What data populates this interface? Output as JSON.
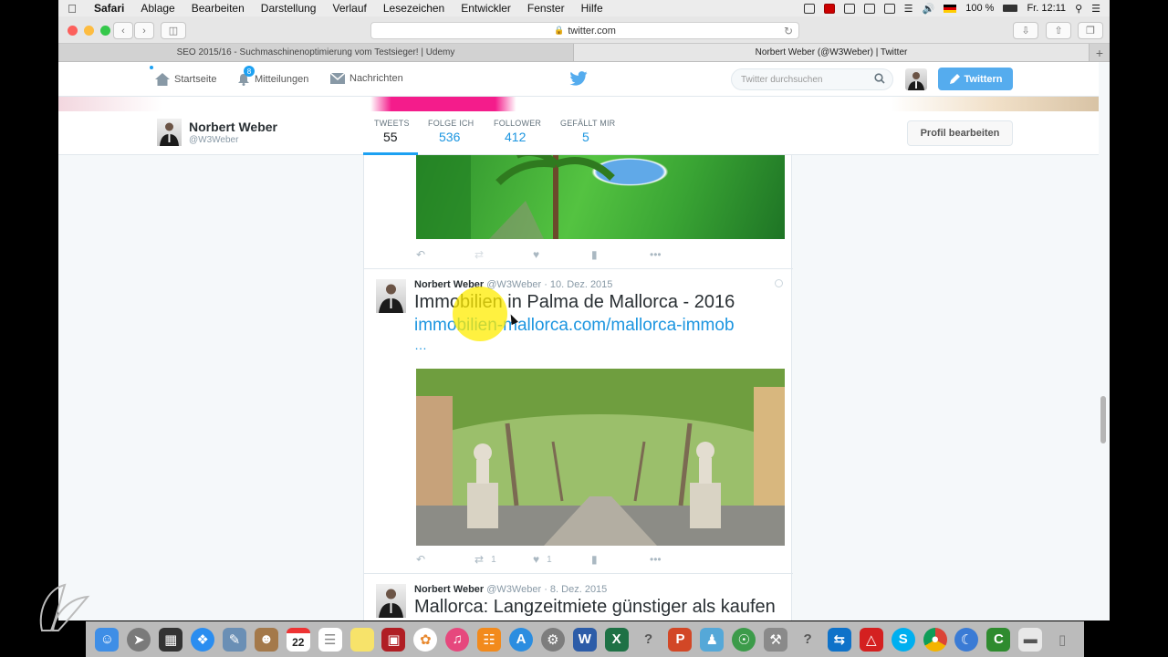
{
  "menubar": {
    "items": [
      "Safari",
      "Ablage",
      "Bearbeiten",
      "Darstellung",
      "Verlauf",
      "Lesezeichen",
      "Entwickler",
      "Fenster",
      "Hilfe"
    ],
    "battery": "100 %",
    "clock": "Fr. 12:11"
  },
  "safari": {
    "url": "twitter.com",
    "tabs": [
      "SEO 2015/16 - Suchmaschinenoptimierung vom Testsieger! | Udemy",
      "Norbert Weber (@W3Weber) | Twitter"
    ]
  },
  "twitter": {
    "nav": {
      "home": "Startseite",
      "notifications": "Mitteilungen",
      "notifications_badge": "8",
      "messages": "Nachrichten",
      "search_placeholder": "Twitter durchsuchen",
      "tweet_button": "Twittern"
    },
    "profile": {
      "name": "Norbert Weber",
      "handle": "@W3Weber",
      "edit_button": "Profil bearbeiten",
      "stats": [
        {
          "label": "TWEETS",
          "value": "55"
        },
        {
          "label": "FOLGE ICH",
          "value": "536"
        },
        {
          "label": "FOLLOWER",
          "value": "412"
        },
        {
          "label": "GEFÄLLT MIR",
          "value": "5"
        }
      ]
    },
    "tweets": [
      {
        "name": "Norbert Weber",
        "handle": "@W3Weber",
        "date": "· 10. Dez. 2015",
        "title": "Immobilien in Palma de Mallorca - 2016",
        "link": "immobilien-mallorca.com/mallorca-immob",
        "ellipsis": "…",
        "retweets": "1",
        "likes": "1"
      },
      {
        "name": "Norbert Weber",
        "handle": "@W3Weber",
        "date": "· 8. Dez. 2015",
        "title": "Mallorca: Langzeitmiete günstiger als kaufen"
      }
    ]
  },
  "dock": {
    "calendar_day": "22"
  }
}
